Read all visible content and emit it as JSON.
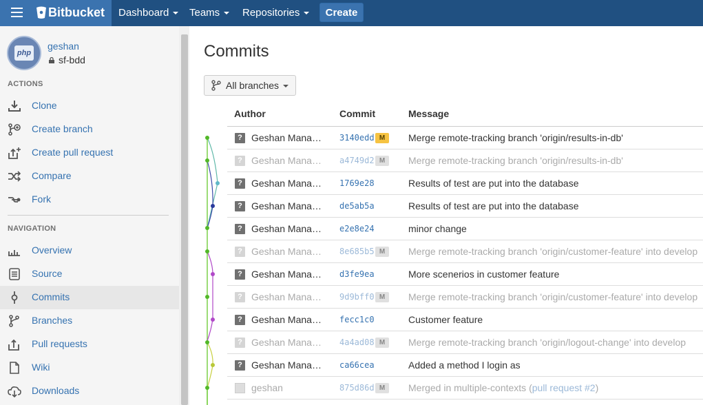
{
  "topbar": {
    "brand": "Bitbucket",
    "nav": [
      "Dashboard",
      "Teams",
      "Repositories"
    ],
    "create_label": "Create",
    "colors": {
      "bar": "#205081",
      "brand_bg": "#3b73af"
    }
  },
  "repo": {
    "owner": "geshan",
    "name": "sf-bdd",
    "avatar_text": "php"
  },
  "sidebar": {
    "actions_heading": "ACTIONS",
    "actions": [
      {
        "label": "Clone",
        "icon": "clone-icon"
      },
      {
        "label": "Create branch",
        "icon": "create-branch-icon"
      },
      {
        "label": "Create pull request",
        "icon": "create-pull-request-icon"
      },
      {
        "label": "Compare",
        "icon": "compare-icon"
      },
      {
        "label": "Fork",
        "icon": "fork-icon"
      }
    ],
    "navigation_heading": "NAVIGATION",
    "navigation": [
      {
        "label": "Overview",
        "icon": "overview-icon"
      },
      {
        "label": "Source",
        "icon": "source-icon"
      },
      {
        "label": "Commits",
        "icon": "commits-icon",
        "active": true
      },
      {
        "label": "Branches",
        "icon": "branches-icon"
      },
      {
        "label": "Pull requests",
        "icon": "pull-requests-icon"
      },
      {
        "label": "Wiki",
        "icon": "wiki-icon"
      },
      {
        "label": "Downloads",
        "icon": "downloads-icon"
      }
    ]
  },
  "main": {
    "title": "Commits",
    "branch_filter": "All branches",
    "columns": {
      "author": "Author",
      "commit": "Commit",
      "message": "Message"
    },
    "commits": [
      {
        "author": "Geshan Manandhar",
        "hash": "3140edd",
        "badge": "M",
        "message": "Merge remote-tracking branch 'origin/results-in-db'",
        "merge": false
      },
      {
        "author": "Geshan Manandhar",
        "hash": "a4749d2",
        "badge": "M",
        "message": "Merge remote-tracking branch 'origin/results-in-db'",
        "merge": true
      },
      {
        "author": "Geshan Manandhar",
        "hash": "1769e28",
        "badge": "",
        "message": "Results of test are put into the database",
        "merge": false
      },
      {
        "author": "Geshan Manandhar",
        "hash": "de5ab5a",
        "badge": "",
        "message": "Results of test are put into the database",
        "merge": false
      },
      {
        "author": "Geshan Manandhar",
        "hash": "e2e8e24",
        "badge": "",
        "message": "minor change",
        "merge": false
      },
      {
        "author": "Geshan Manandhar",
        "hash": "8e685b5",
        "badge": "M",
        "message": "Merge remote-tracking branch 'origin/customer-feature' into develop",
        "merge": true
      },
      {
        "author": "Geshan Manandhar",
        "hash": "d3fe9ea",
        "badge": "",
        "message": "More scenerios in customer feature",
        "merge": false
      },
      {
        "author": "Geshan Manandhar",
        "hash": "9d9bff0",
        "badge": "M",
        "message": "Merge remote-tracking branch 'origin/customer-feature' into develop",
        "merge": true
      },
      {
        "author": "Geshan Manandhar",
        "hash": "fecc1c0",
        "badge": "",
        "message": "Customer feature",
        "merge": false
      },
      {
        "author": "Geshan Manandhar",
        "hash": "4a4ad08",
        "badge": "M",
        "message": "Merge remote-tracking branch 'origin/logout-change' into develop",
        "merge": true
      },
      {
        "author": "Geshan Manandhar",
        "hash": "ca66cea",
        "badge": "",
        "message": "Added a method I login as",
        "merge": false
      },
      {
        "author": "geshan",
        "hash": "875d86d",
        "badge": "M",
        "message": "Merged in multiple-contexts (",
        "link": "pull request #2",
        "message_end": ")",
        "merge": true,
        "user_avatar": true
      }
    ]
  }
}
